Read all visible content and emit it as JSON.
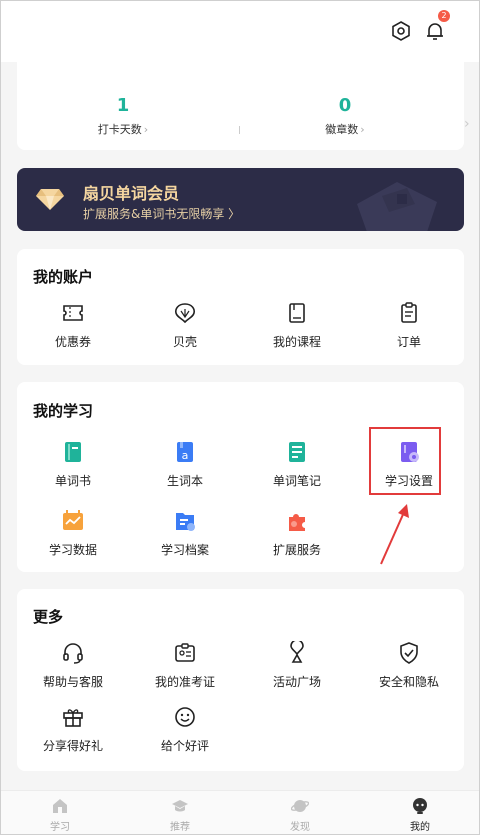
{
  "header": {
    "notification_count": "2"
  },
  "stats": [
    {
      "value": "1",
      "label": "打卡天数"
    },
    {
      "value": "0",
      "label": "徽章数"
    }
  ],
  "member": {
    "title": "扇贝单词会员",
    "subtitle": "扩展服务&单词书无限畅享 〉",
    "accent": "#f5d6a0",
    "background": "#2c2c47"
  },
  "account": {
    "title": "我的账户",
    "items": [
      {
        "label": "优惠券",
        "icon": "coupon-icon"
      },
      {
        "label": "贝壳",
        "icon": "shell-icon"
      },
      {
        "label": "我的课程",
        "icon": "course-icon"
      },
      {
        "label": "订单",
        "icon": "order-icon"
      }
    ]
  },
  "study": {
    "title": "我的学习",
    "items": [
      {
        "label": "单词书",
        "icon": "wordbook-icon"
      },
      {
        "label": "生词本",
        "icon": "vocab-notebook-icon"
      },
      {
        "label": "单词笔记",
        "icon": "word-notes-icon"
      },
      {
        "label": "学习设置",
        "icon": "study-settings-icon"
      },
      {
        "label": "学习数据",
        "icon": "study-data-icon"
      },
      {
        "label": "学习档案",
        "icon": "study-archive-icon"
      },
      {
        "label": "扩展服务",
        "icon": "puzzle-icon"
      }
    ]
  },
  "more": {
    "title": "更多",
    "items": [
      {
        "label": "帮助与客服",
        "icon": "headset-icon"
      },
      {
        "label": "我的准考证",
        "icon": "admission-ticket-icon"
      },
      {
        "label": "活动广场",
        "icon": "activity-icon"
      },
      {
        "label": "安全和隐私",
        "icon": "shield-icon"
      },
      {
        "label": "分享得好礼",
        "icon": "gift-icon"
      },
      {
        "label": "给个好评",
        "icon": "smile-icon"
      }
    ]
  },
  "nav": [
    {
      "label": "学习",
      "icon": "home-icon"
    },
    {
      "label": "推荐",
      "icon": "graduation-cap-icon"
    },
    {
      "label": "发现",
      "icon": "planet-icon"
    },
    {
      "label": "我的",
      "icon": "profile-icon",
      "active": true
    }
  ],
  "colors": {
    "teal": "#1fb39a",
    "blue": "#3b7cf5",
    "red": "#f55b47",
    "purple": "#7b5cf0",
    "orange": "#f7a23b",
    "highlight": "#e23b3b"
  }
}
